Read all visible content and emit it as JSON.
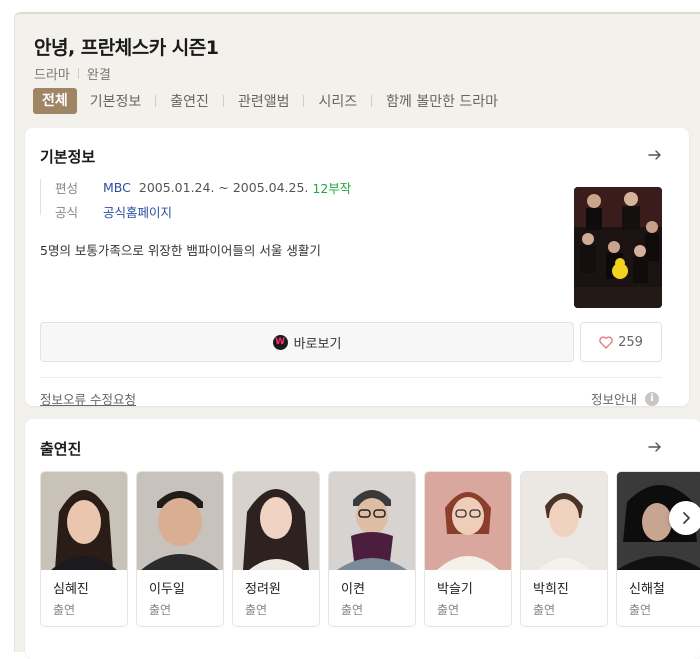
{
  "header": {
    "title": "안녕, 프란체스카 시즌1",
    "meta": [
      "드라마",
      "완결"
    ]
  },
  "tabs": [
    {
      "label": "전체",
      "active": true
    },
    {
      "label": "기본정보",
      "active": false
    },
    {
      "label": "출연진",
      "active": false
    },
    {
      "label": "관련앨범",
      "active": false
    },
    {
      "label": "시리즈",
      "active": false
    },
    {
      "label": "함께 볼만한 드라마",
      "active": false
    }
  ],
  "basic_info": {
    "title": "기본정보",
    "schedule_label": "편성",
    "channel": "MBC",
    "dates": "2005.01.24. ~ 2005.04.25.",
    "episodes": "12부작",
    "official_label": "공식",
    "official_link": "공식홈페이지",
    "description": "5명의 보통가족으로 위장한 뱀파이어들의 서울 생활기",
    "watch_label": "바로보기",
    "watch_logo": "W",
    "likes": "259",
    "report_label": "정보오류 수정요청",
    "guide_label": "정보안내",
    "info_icon_glyph": "i"
  },
  "cast": {
    "title": "출연진",
    "members": [
      {
        "name": "심혜진",
        "role": "출연"
      },
      {
        "name": "이두일",
        "role": "출연"
      },
      {
        "name": "정려원",
        "role": "출연"
      },
      {
        "name": "이켠",
        "role": "출연"
      },
      {
        "name": "박슬기",
        "role": "출연"
      },
      {
        "name": "박희진",
        "role": "출연"
      },
      {
        "name": "신해철",
        "role": "출연"
      }
    ]
  },
  "colors": {
    "accent": "#a08466",
    "link": "#2b4f9e",
    "green": "#1eaa44",
    "panel_bg": "#f3f1ec"
  },
  "icons": [
    "arrow-right-icon",
    "heart-icon",
    "info-icon",
    "chevron-right-icon"
  ]
}
